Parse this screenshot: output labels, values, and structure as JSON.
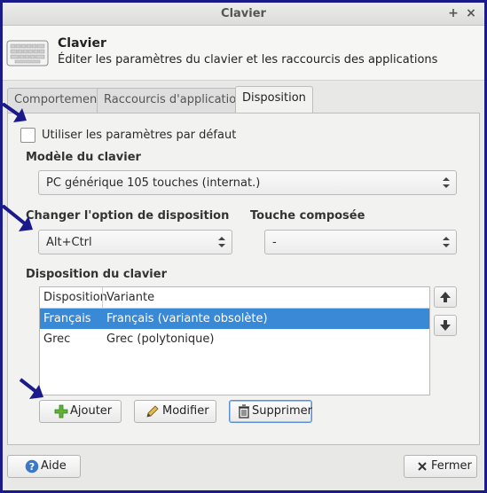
{
  "window": {
    "title": "Clavier"
  },
  "header": {
    "title": "Clavier",
    "subtitle": "Éditer les paramètres du clavier et les raccourcis des applications"
  },
  "tabs": [
    {
      "label": "Comportement",
      "active": false
    },
    {
      "label": "Raccourcis d'applications",
      "active": false
    },
    {
      "label": "Disposition",
      "active": true
    }
  ],
  "disposition": {
    "use_defaults": {
      "label": "Utiliser les paramètres par défaut",
      "checked": false
    },
    "model": {
      "label": "Modèle du clavier",
      "value": "PC générique 105 touches (internat.)"
    },
    "layout_option": {
      "label": "Changer l'option de disposition",
      "value": "Alt+Ctrl"
    },
    "compose_key": {
      "label": "Touche composée",
      "value": "-"
    },
    "layouts": {
      "label": "Disposition du clavier",
      "columns": [
        "Disposition",
        "Variante"
      ],
      "rows": [
        {
          "layout": "Français",
          "variant": "Français (variante obsolète)",
          "selected": true
        },
        {
          "layout": "Grec",
          "variant": "Grec (polytonique)",
          "selected": false
        }
      ]
    },
    "buttons": {
      "add": "Ajouter",
      "edit": "Modifier",
      "delete": "Supprimer"
    }
  },
  "footer": {
    "help": "Aide",
    "close": "Fermer"
  },
  "colors": {
    "selection": "#3a89d6",
    "annotation_arrow": "#1a1a8a",
    "frame": "#1a1a8a"
  }
}
